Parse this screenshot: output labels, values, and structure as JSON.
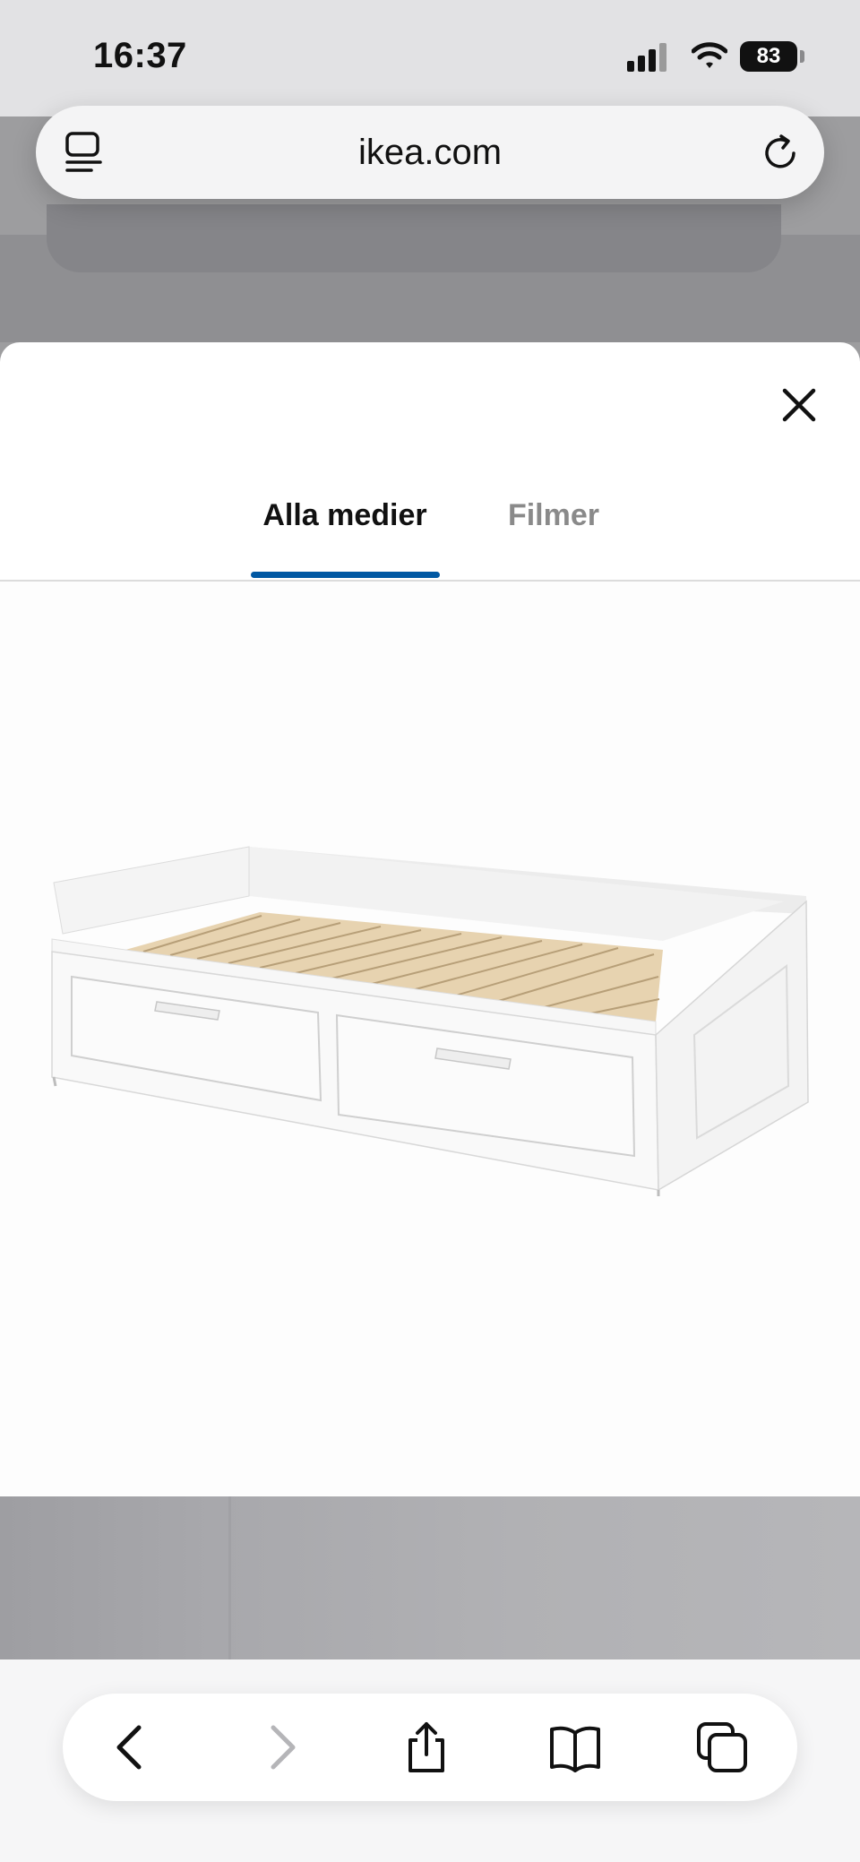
{
  "status_bar": {
    "time": "16:37",
    "battery": "83"
  },
  "browser": {
    "url": "ikea.com"
  },
  "modal": {
    "tabs": [
      {
        "label": "Alla medier",
        "active": true
      },
      {
        "label": "Filmer",
        "active": false
      }
    ],
    "media_alt": "Bäddsoffa med två lådor, vit"
  },
  "toolbar": {
    "icons": [
      "back-icon",
      "forward-icon",
      "share-icon",
      "bookmarks-icon",
      "tabs-icon"
    ]
  },
  "colors": {
    "accent": "#0058a3",
    "inactive_tab": "#8a8a8a"
  }
}
